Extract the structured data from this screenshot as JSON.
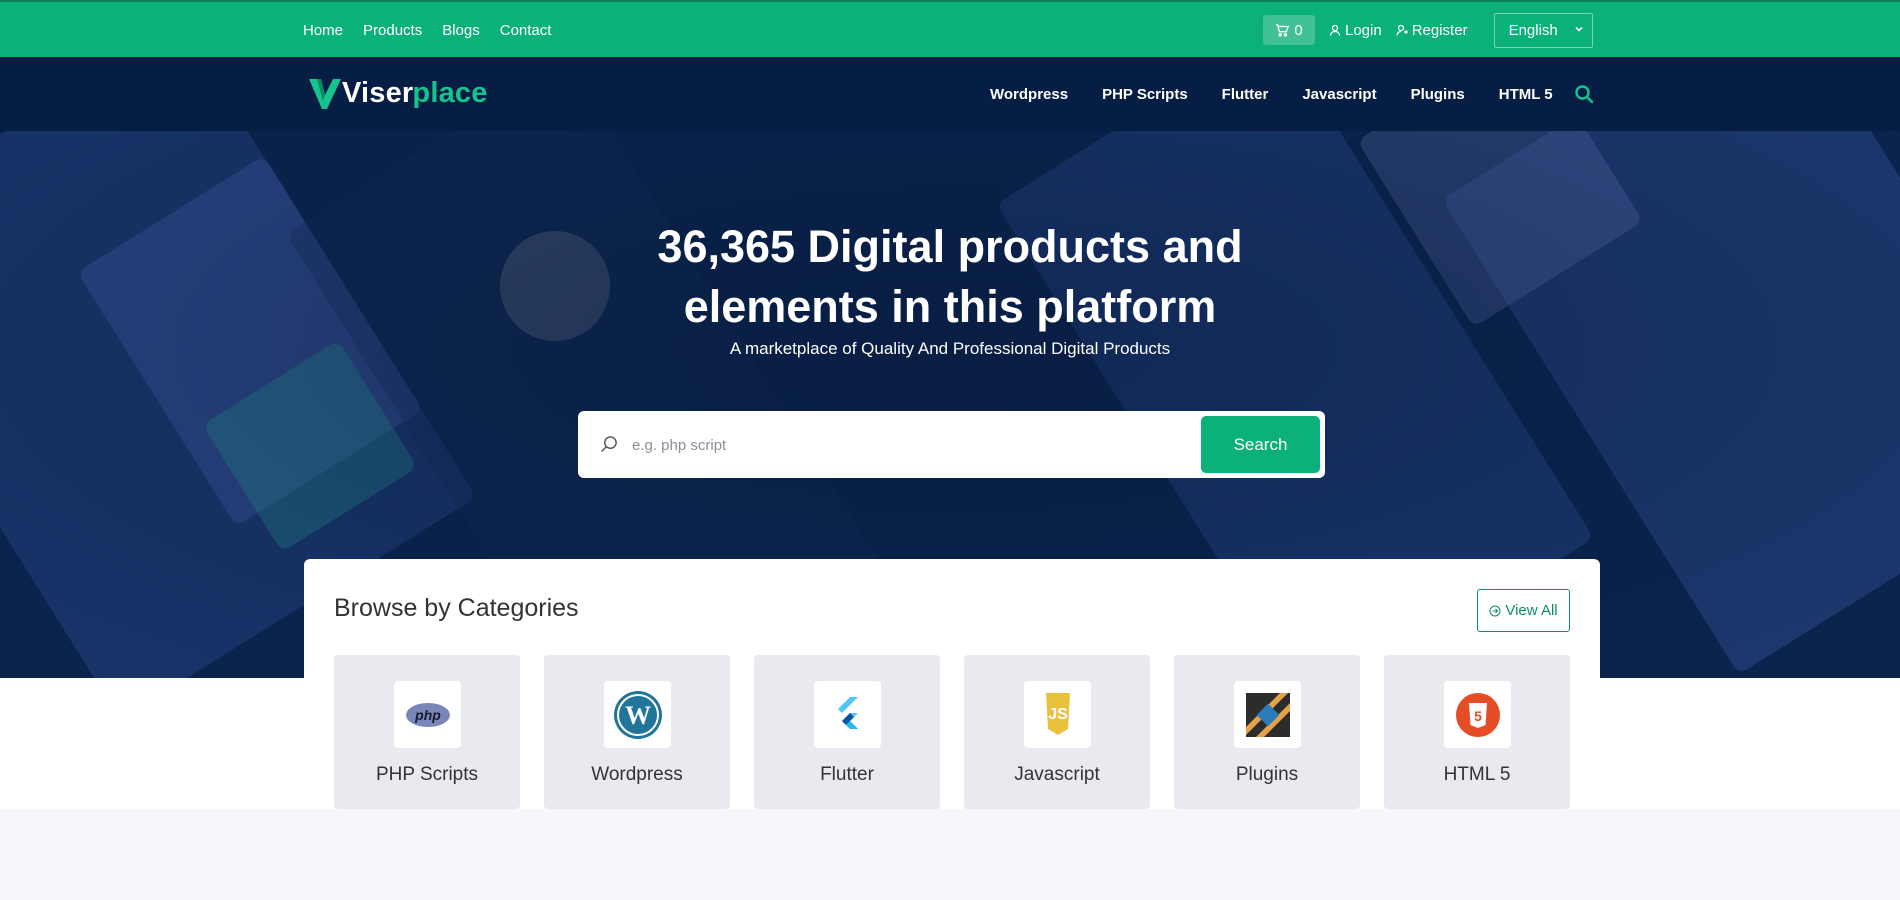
{
  "topbar": {
    "links": [
      "Home",
      "Products",
      "Blogs",
      "Contact"
    ],
    "cart_count": "0",
    "login": "Login",
    "register": "Register",
    "language": "English"
  },
  "header": {
    "logo_part1": "Viser",
    "logo_part2": "place",
    "nav": [
      "Wordpress",
      "PHP Scripts",
      "Flutter",
      "Javascript",
      "Plugins",
      "HTML 5"
    ]
  },
  "hero": {
    "title_line1": "36,365 Digital products and",
    "title_line2": "elements in this platform",
    "subtitle": "A marketplace of Quality And Professional Digital Products",
    "search_placeholder": "e.g. php script",
    "search_button": "Search"
  },
  "categories": {
    "heading": "Browse by Categories",
    "view_all": "View All",
    "items": [
      {
        "label": "PHP Scripts",
        "icon": "php-icon"
      },
      {
        "label": "Wordpress",
        "icon": "wordpress-icon"
      },
      {
        "label": "Flutter",
        "icon": "flutter-icon"
      },
      {
        "label": "Javascript",
        "icon": "javascript-icon"
      },
      {
        "label": "Plugins",
        "icon": "plugins-icon"
      },
      {
        "label": "HTML 5",
        "icon": "html5-icon"
      }
    ]
  },
  "colors": {
    "brand_green": "#0bb07b",
    "header_navy": "#061d44",
    "hero_navy": "#0b2752",
    "category_bg": "#e8eaef"
  }
}
